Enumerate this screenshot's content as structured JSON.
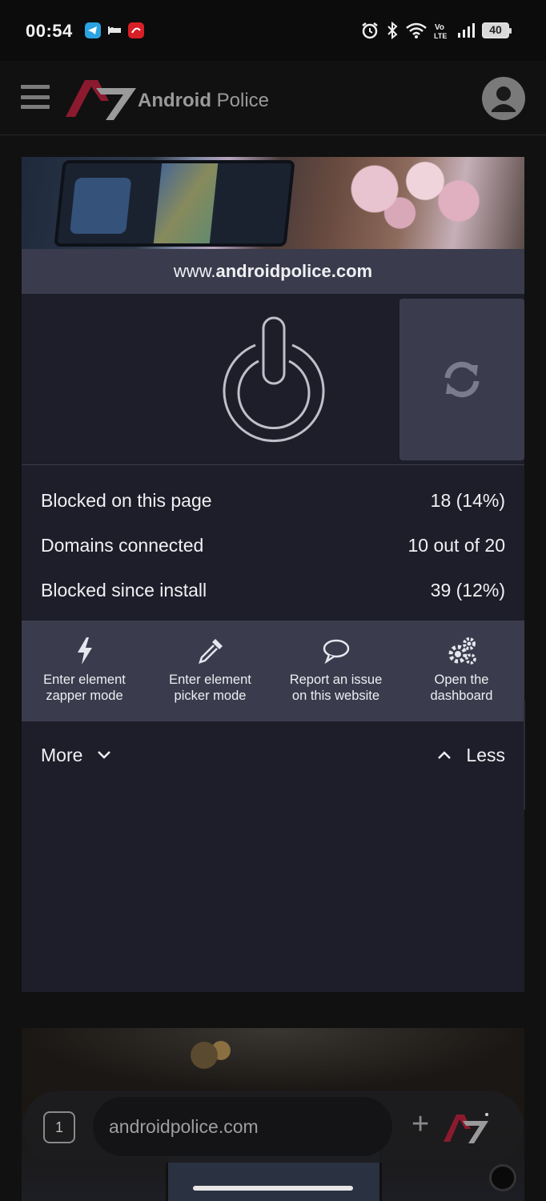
{
  "status_bar": {
    "time": "00:54",
    "battery": "40",
    "icons": [
      "telegram-icon",
      "hotel-icon",
      "airtel-icon",
      "alarm-icon",
      "bluetooth-icon",
      "wifi-icon",
      "volte-icon",
      "signal-icon",
      "battery-icon"
    ]
  },
  "header": {
    "brand_part1": "Android",
    "brand_part2": " Police",
    "menu_icon": "hamburger-menu-icon",
    "account_icon": "account-icon"
  },
  "popup": {
    "hostname_prefix": "www.",
    "hostname_domain": "androidpolice.com",
    "power_icon": "power-icon",
    "refresh_icon": "refresh-icon",
    "stats": [
      {
        "label": "Blocked on this page",
        "value": "18 (14%)"
      },
      {
        "label": "Domains connected",
        "value": "10 out of 20"
      },
      {
        "label": "Blocked since install",
        "value": "39 (12%)"
      }
    ],
    "tools": [
      {
        "label": "Enter element\nzapper mode",
        "icon": "lightning-bolt-icon"
      },
      {
        "label": "Enter element\npicker mode",
        "icon": "eyedropper-icon"
      },
      {
        "label": "Report an issue\non this website",
        "icon": "speech-bubble-icon"
      },
      {
        "label": "Open the\ndashboard",
        "icon": "gears-icon"
      }
    ],
    "more_label": "More",
    "less_label": "Less"
  },
  "browser_bar": {
    "tab_count": "1",
    "url": "androidpolice.com",
    "new_tab_label": "+"
  },
  "colors": {
    "panel_bg": "#1e1e2a",
    "panel_header_bg": "#3a3b4c",
    "brand_red": "#8c1a2e",
    "text": "#f0f0f4"
  }
}
